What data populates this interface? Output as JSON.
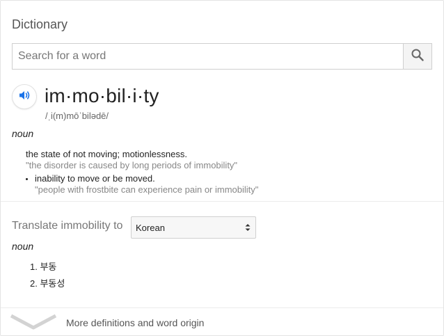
{
  "header": {
    "title": "Dictionary"
  },
  "search": {
    "placeholder": "Search for a word"
  },
  "entry": {
    "word": "im·mo·bil·i·ty",
    "pronunciation": "/ˌi(m)mōˈbilədē/",
    "part_of_speech": "noun",
    "definitions": [
      {
        "text": "the state of not moving; motionlessness.",
        "example": "\"the disorder is caused by long periods of immobility\""
      },
      {
        "text": "inability to move or be moved.",
        "example": "\"people with frostbite can experience pain or immobility\""
      }
    ]
  },
  "translate": {
    "label": "Translate immobility to",
    "language": "Korean",
    "part_of_speech": "noun",
    "results": [
      "1. 부동",
      "2. 부동성"
    ]
  },
  "footer": {
    "more_label": "More definitions and word origin"
  },
  "colors": {
    "accent": "#1a73e8",
    "muted": "#878787"
  }
}
